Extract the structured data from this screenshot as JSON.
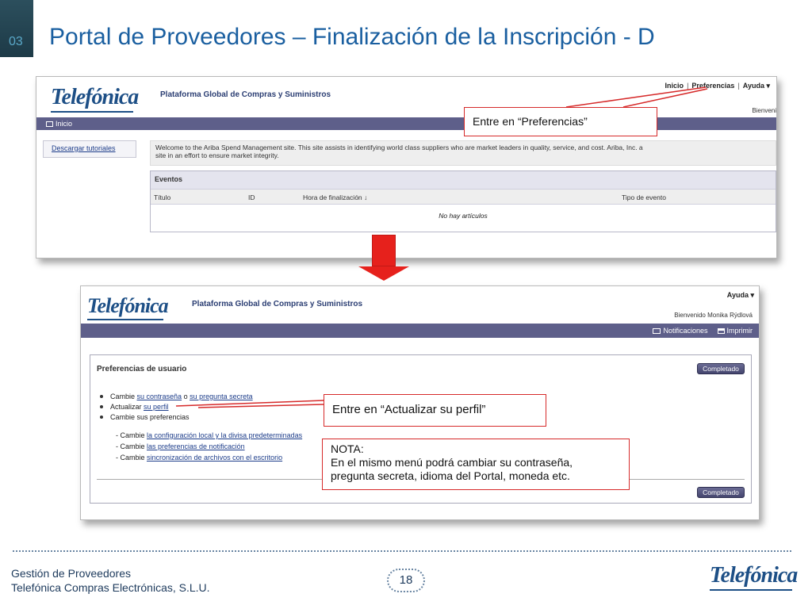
{
  "slide": {
    "number": "03",
    "title": "Portal de Proveedores – Finalización de la Inscripción - D",
    "page": "18"
  },
  "footer": {
    "line1": "Gestión de Proveedores",
    "line2": "Telefónica Compras Electrónicas, S.L.U.",
    "logo": "Telefónica"
  },
  "shot1": {
    "logo": "Telefónica",
    "app_title": "Plataforma Global de Compras y Suministros",
    "nav": {
      "inicio": "Inicio",
      "preferencias": "Preferencias",
      "ayuda": "Ayuda ▾"
    },
    "bienvenido": "Bienveni",
    "home_link": "Inicio",
    "side_link": "Descargar tutoriales",
    "welcome_line1": "Welcome to the Ariba Spend Management site. This site assists in identifying world class suppliers who are market leaders in quality, service, and cost. Ariba, Inc. a",
    "welcome_line2": "site in an effort to ensure market integrity.",
    "events": {
      "title": "Eventos",
      "columns": [
        "Título",
        "ID",
        "Hora de finalización ↓",
        "Tipo de evento"
      ],
      "empty": "No hay artículos"
    }
  },
  "shot2": {
    "logo": "Telefónica",
    "app_title": "Plataforma Global de Compras y Suministros",
    "ayuda": "Ayuda ▾",
    "bienvenido": "Bienvenido Monika Rýdlová",
    "notificaciones": "Notificaciones",
    "imprimir": "Imprimir",
    "prefs_title": "Preferencias de usuario",
    "completado": "Completado",
    "item1": {
      "prefix": "Cambie ",
      "link1": "su contraseña",
      "mid": " o ",
      "link2": "su pregunta secreta"
    },
    "item2": {
      "prefix": "Actualizar ",
      "link": "su perfil"
    },
    "item3": "Cambie sus preferencias",
    "sub1": {
      "prefix": "- Cambie ",
      "link": "la configuración local y la divisa predeterminadas"
    },
    "sub2": {
      "prefix": "- Cambie ",
      "link": "las preferencias de notificación"
    },
    "sub3": {
      "prefix": "- Cambie ",
      "link": "sincronización de archivos con el escritorio"
    }
  },
  "callouts": {
    "preferencias": "Entre en “Preferencias”",
    "perfil": "Entre en “Actualizar su perfil”",
    "nota_title": "NOTA:",
    "nota_line1": "En el mismo menú podrá cambiar su contraseña,",
    "nota_line2": "pregunta secreta, idioma del Portal, moneda etc."
  },
  "colors": {
    "accent_red": "#e6211c",
    "brand_blue": "#1a5fa0",
    "nav_purple": "#5e5f8a"
  }
}
